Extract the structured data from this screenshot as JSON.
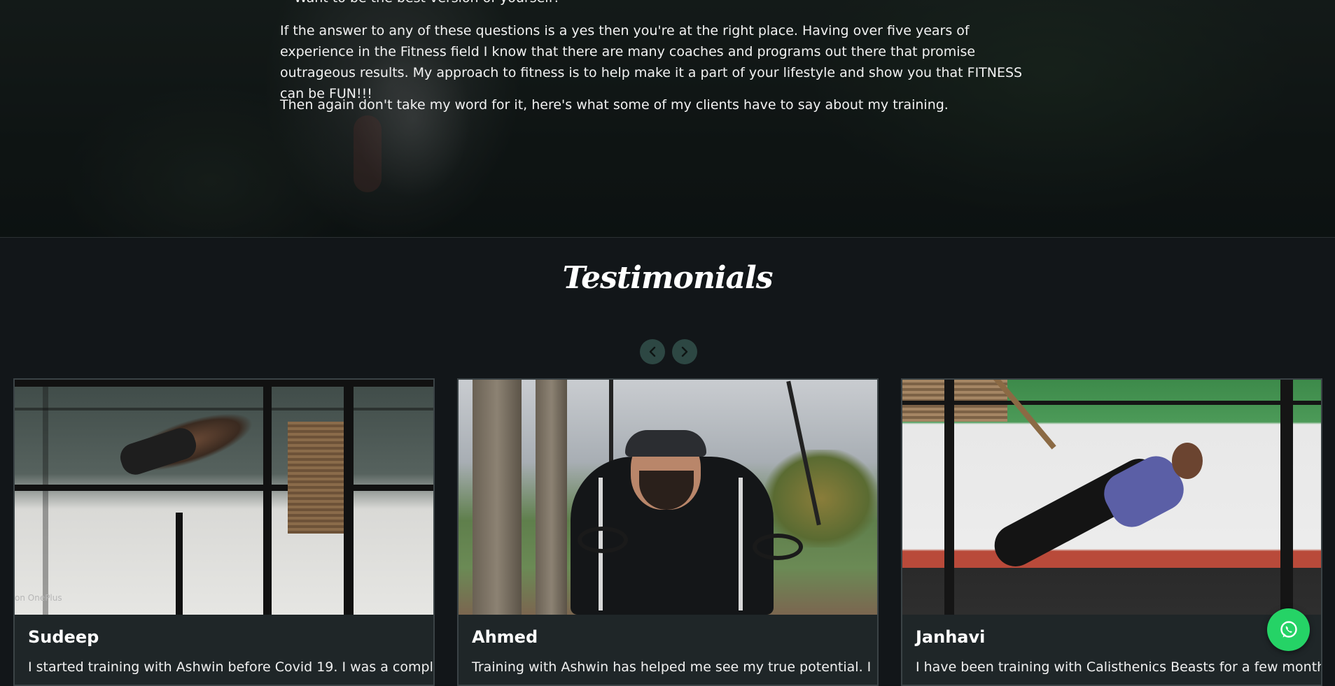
{
  "intro": {
    "bullet_partial": "Want to be the best version of yourself?",
    "paragraph1": "If the answer to any of these questions is a yes then you're at the right place. Having over five years of experience in the Fitness field I know that there are many coaches and programs out there that promise outrageous results. My approach to fitness is to help make it a part of your lifestyle and show you that FITNESS can be FUN!!!",
    "paragraph2": "Then again don't take my word for it, here's what some of my clients have to say about my training."
  },
  "testimonials": {
    "title": "Testimonials",
    "nav": {
      "prev_icon": "chevron-left-icon",
      "next_icon": "chevron-right-icon"
    },
    "cards": [
      {
        "name": "Sudeep",
        "quote": "I started training with Ashwin before Covid 19. I was a complete",
        "image_watermark": "on OnePlus"
      },
      {
        "name": "Ahmed",
        "quote": "Training with Ashwin has helped me see my true potential. I"
      },
      {
        "name": "Janhavi",
        "quote": "I have been training with Calisthenics Beasts for a few months"
      }
    ]
  },
  "floating": {
    "whatsapp_icon": "whatsapp-icon"
  },
  "colors": {
    "background": "#121619",
    "card_background": "#1f2628",
    "nav_button": "#2d4743",
    "whatsapp": "#25d366"
  }
}
